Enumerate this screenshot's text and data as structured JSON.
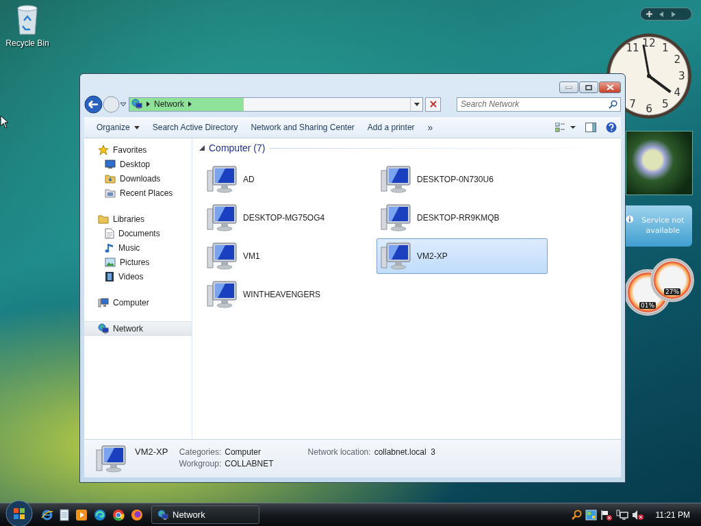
{
  "desktop": {
    "icons": [
      {
        "label": "Recycle Bin"
      }
    ]
  },
  "gadgets": {
    "clock": {
      "numerals": [
        "11",
        "12",
        "1",
        "2",
        "3",
        "4",
        "5",
        "6",
        "7"
      ]
    },
    "weather": {
      "message": "Service not available"
    },
    "meters": [
      {
        "reading": "01%"
      },
      {
        "reading": "27%"
      }
    ]
  },
  "window": {
    "address": {
      "path": [
        "Network"
      ],
      "level": 0.39
    },
    "search": {
      "placeholder": "Search Network"
    },
    "toolbar": [
      {
        "label": "Organize",
        "kind": "menu"
      },
      {
        "label": "Search Active Directory",
        "kind": "button"
      },
      {
        "label": "Network and Sharing Center",
        "kind": "button"
      },
      {
        "label": "Add a printer",
        "kind": "button"
      },
      {
        "label": "»",
        "kind": "overflow"
      }
    ],
    "navigation": [
      {
        "label": "Favorites",
        "selected": false,
        "children": [
          {
            "label": "Desktop",
            "selected": false
          },
          {
            "label": "Downloads",
            "selected": false
          },
          {
            "label": "Recent Places",
            "selected": false
          }
        ]
      },
      {
        "label": "Libraries",
        "selected": false,
        "children": [
          {
            "label": "Documents",
            "selected": false
          },
          {
            "label": "Music",
            "selected": false
          },
          {
            "label": "Pictures",
            "selected": false
          },
          {
            "label": "Videos",
            "selected": false
          }
        ]
      },
      {
        "label": "Computer",
        "selected": false
      },
      {
        "label": "Network",
        "selected": true
      }
    ],
    "content": {
      "groups": [
        {
          "title": "Computer (7)",
          "expanded": true,
          "items": [
            {
              "label": "AD",
              "selected": false
            },
            {
              "label": "DESKTOP-0N730U6",
              "selected": false
            },
            {
              "label": "DESKTOP-MG75OG4",
              "selected": false
            },
            {
              "label": "DESKTOP-RR9KMQB",
              "selected": false
            },
            {
              "label": "VM1",
              "selected": false
            },
            {
              "label": "VM2-XP",
              "selected": true
            },
            {
              "label": "WINTHEAVENGERS",
              "selected": false
            }
          ]
        }
      ]
    },
    "details": {
      "name": "VM2-XP",
      "columns": [
        [
          {
            "label": "Categories:",
            "value": "Computer"
          },
          {
            "label": "Workgroup:",
            "value": "COLLABNET"
          }
        ],
        [
          {
            "label": "Network location:",
            "value": "collabnet.local  3"
          }
        ]
      ]
    }
  },
  "taskbar": {
    "buttons": [
      {
        "label": "Network"
      }
    ],
    "time": "11:21 PM"
  }
}
